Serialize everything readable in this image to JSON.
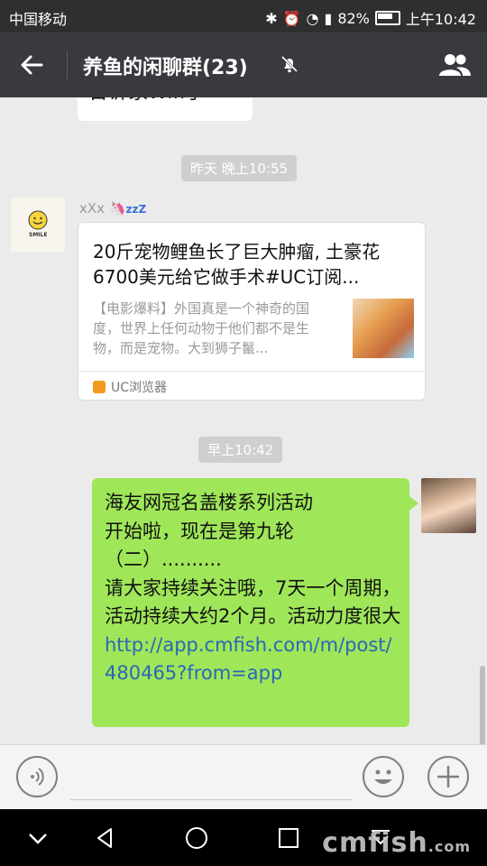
{
  "status_bar": {
    "carrier": "中国移动",
    "battery": "82%",
    "time": "上午10:42"
  },
  "header": {
    "title": "养鱼的闲聊群(23)",
    "back_icon": "back-arrow-icon",
    "mute_icon": "bell-muted-icon",
    "members_icon": "group-members-icon"
  },
  "chat": {
    "partial_message": "告诉家Wifi了",
    "timestamps": [
      "昨天 晚上10:55",
      "早上10:42"
    ],
    "shared_card": {
      "sender": "xXx",
      "title": "20斤宠物鲤鱼长了巨大肿瘤, 土豪花6700美元给它做手术#UC订阅...",
      "description": "【电影爆料】外国真是一个神奇的国度，世界上任何动物于他们都不是生物，而是宠物。大到狮子鬣...",
      "source": "UC浏览器",
      "avatar_text": "SMILE"
    },
    "my_message": {
      "text": "海友网冠名盖楼系列活动\n开始啦，现在是第九轮\n（二）..........\n请大家持续关注哦，7天一个周期，活动持续大约2个月。活动力度很大 ",
      "link": "http://app.cmfish.com/m/post/480465?from=app"
    }
  },
  "input_bar": {
    "voice_icon": "voice-input-icon",
    "emoji_icon": "emoji-icon",
    "plus_icon": "plus-icon",
    "placeholder": ""
  },
  "nav_bar": {
    "watermark": "cmfish",
    "watermark_suffix": ".com"
  },
  "colors": {
    "titlebar": "#393a3f",
    "bubble_green": "#9fe659",
    "link": "#2a67b6"
  }
}
